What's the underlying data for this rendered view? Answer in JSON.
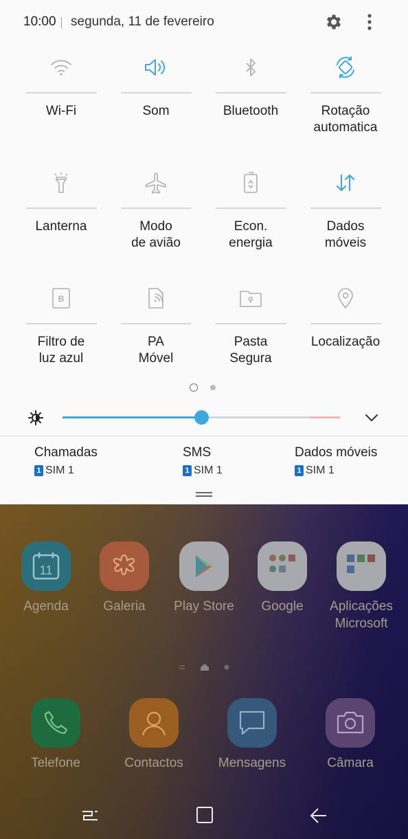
{
  "status": {
    "time": "10:00",
    "date": "segunda, 11 de fevereiro"
  },
  "quick_tiles": [
    {
      "label": "Wi-Fi",
      "icon": "wifi-icon",
      "active": false
    },
    {
      "label": "Som",
      "icon": "speaker-icon",
      "active": true
    },
    {
      "label": "Bluetooth",
      "icon": "bluetooth-icon",
      "active": false
    },
    {
      "label": "Rotação\nautomatica",
      "icon": "rotation-icon",
      "active": true
    },
    {
      "label": "Lanterna",
      "icon": "flashlight-icon",
      "active": false
    },
    {
      "label": "Modo\nde avião",
      "icon": "airplane-icon",
      "active": false
    },
    {
      "label": "Econ.\nenergia",
      "icon": "battery-saver-icon",
      "active": false
    },
    {
      "label": "Dados\nmóveis",
      "icon": "mobile-data-icon",
      "active": true
    },
    {
      "label": "Filtro de\nluz azul",
      "icon": "blue-light-filter-icon",
      "active": false
    },
    {
      "label": "PA\nMóvel",
      "icon": "mobile-hotspot-icon",
      "active": false
    },
    {
      "label": "Pasta\nSegura",
      "icon": "secure-folder-icon",
      "active": false
    },
    {
      "label": "Localização",
      "icon": "location-icon",
      "active": false
    }
  ],
  "brightness": {
    "level": 0.5
  },
  "sim_settings": [
    {
      "title": "Chamadas",
      "sim": "SIM 1",
      "badge": "1"
    },
    {
      "title": "SMS",
      "sim": "SIM 1",
      "badge": "1"
    },
    {
      "title": "Dados móveis",
      "sim": "SIM 1",
      "badge": "1"
    }
  ],
  "home_apps": [
    {
      "label": "Agenda",
      "icon": "calendar-icon",
      "day": "11"
    },
    {
      "label": "Galeria",
      "icon": "gallery-icon"
    },
    {
      "label": "Play Store",
      "icon": "play-store-icon"
    },
    {
      "label": "Google",
      "icon": "google-folder-icon"
    },
    {
      "label": "Aplicações\nMicrosoft",
      "icon": "microsoft-folder-icon"
    }
  ],
  "dock_apps": [
    {
      "label": "Telefone",
      "icon": "phone-icon"
    },
    {
      "label": "Contactos",
      "icon": "contacts-icon"
    },
    {
      "label": "Mensagens",
      "icon": "messages-icon"
    },
    {
      "label": "Câmara",
      "icon": "camera-icon"
    }
  ],
  "colors": {
    "accent": "#3ea9d8",
    "sim_badge": "#1e6fc0"
  }
}
